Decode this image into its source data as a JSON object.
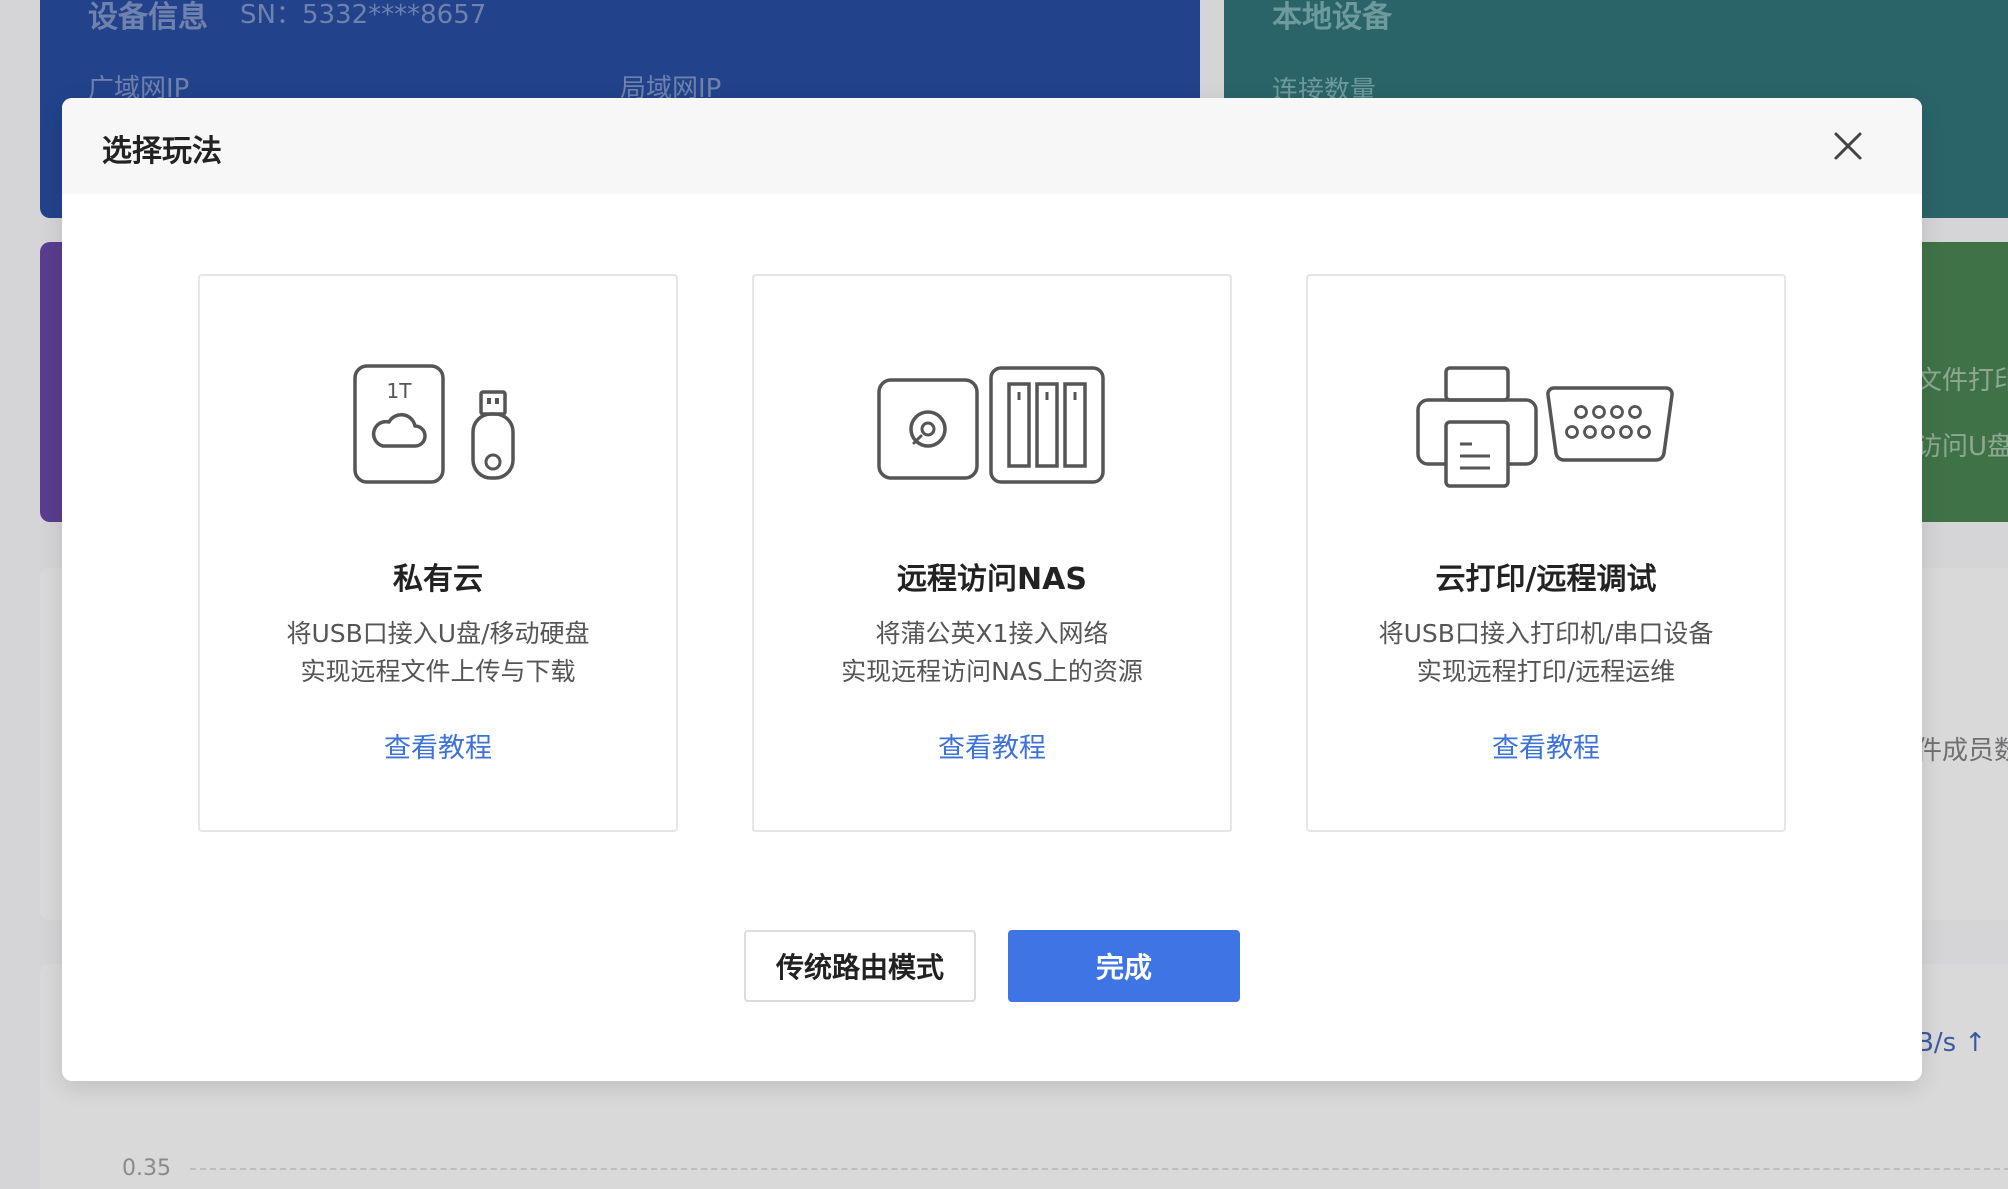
{
  "background": {
    "device_card": {
      "title": "设备信息",
      "sn": "SN：5332****8657",
      "wan_label": "广域网IP",
      "lan_label": "局域网IP"
    },
    "local_card": {
      "title": "本地设备",
      "connections_label": "连接数量"
    },
    "side_texts": {
      "file_print": "文件打印",
      "usb_access": "访问U盘",
      "members": "件成员数",
      "speed": "B/s ↑"
    },
    "chart_tick": "0.35"
  },
  "modal": {
    "title": "选择玩法",
    "cards": [
      {
        "title": "私有云",
        "desc_line1": "将USB口接入U盘/移动硬盘",
        "desc_line2": "实现远程文件上传与下载",
        "link": "查看教程",
        "icon_badge": "1T",
        "icons": [
          "cloud-disk-icon",
          "usb-drive-icon"
        ]
      },
      {
        "title": "远程访问NAS",
        "desc_line1": "将蒲公英X1接入网络",
        "desc_line2": "实现远程访问NAS上的资源",
        "link": "查看教程",
        "icons": [
          "disk-icon",
          "nas-icon"
        ]
      },
      {
        "title": "云打印/远程调试",
        "desc_line1": "将USB口接入打印机/串口设备",
        "desc_line2": "实现远程打印/远程运维",
        "link": "查看教程",
        "icons": [
          "printer-icon",
          "serial-port-icon"
        ]
      }
    ],
    "buttons": {
      "secondary": "传统路由模式",
      "primary": "完成"
    }
  },
  "colors": {
    "primary": "#3e74e3",
    "link": "#3d72d9"
  }
}
